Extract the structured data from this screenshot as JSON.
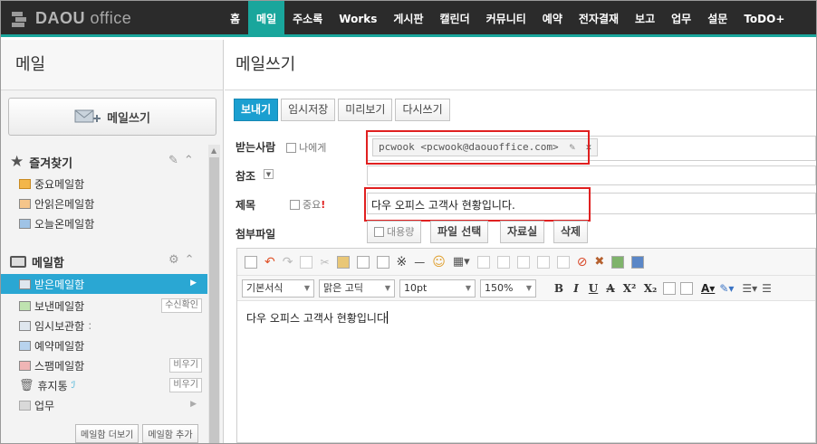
{
  "app": {
    "logo_bold": "DAOU",
    "logo_light": "office"
  },
  "nav": [
    {
      "label": "홈"
    },
    {
      "label": "메일"
    },
    {
      "label": "주소록"
    },
    {
      "label": "Works"
    },
    {
      "label": "게시판"
    },
    {
      "label": "캘린더"
    },
    {
      "label": "커뮤니티"
    },
    {
      "label": "예약"
    },
    {
      "label": "전자결재"
    },
    {
      "label": "보고"
    },
    {
      "label": "업무"
    },
    {
      "label": "설문"
    },
    {
      "label": "ToDO+"
    }
  ],
  "nav_active_index": 1,
  "sidebar": {
    "title": "메일",
    "compose_label": "메일쓰기",
    "favorites": {
      "label": "즐겨찾기",
      "items": [
        {
          "label": "중요메일함"
        },
        {
          "label": "안읽은메일함"
        },
        {
          "label": "오늘온메일함"
        }
      ]
    },
    "mailbox": {
      "label": "메일함",
      "items": [
        {
          "label": "받은메일함",
          "selected": true
        },
        {
          "label": "보낸메일함",
          "tag": "수신확인"
        },
        {
          "label": "임시보관함",
          "suffix": ":"
        },
        {
          "label": "예약메일함"
        },
        {
          "label": "스팸메일함",
          "tag": "비우기"
        },
        {
          "label": "휴지통",
          "tag": "비우기",
          "suffix": "ℐ"
        },
        {
          "label": "업무"
        }
      ]
    },
    "more_label": "메일함 더보기",
    "add_label": "메일함 추가"
  },
  "main": {
    "title": "메일쓰기",
    "buttons": {
      "send": "보내기",
      "temp_save": "임시저장",
      "preview": "미리보기",
      "rewrite": "다시쓰기"
    },
    "to": {
      "label": "받는사람",
      "self_option": "나에게",
      "recipient": "pcwook <pcwook@daouoffice.com>"
    },
    "cc": {
      "label": "참조"
    },
    "subject": {
      "label": "제목",
      "important_option": "중요",
      "important_mark": "!",
      "value": "다우 오피스 고객사 현황입니다."
    },
    "attach": {
      "label": "첨부파일",
      "large_option": "대용량",
      "select_file": "파일 선택",
      "library": "자료실",
      "delete": "삭제"
    },
    "editor": {
      "style": "기본서식",
      "font": "맑은 고딕",
      "size": "10pt",
      "zoom": "150%",
      "format_buttons": [
        "B",
        "I",
        "U",
        "A",
        "X²",
        "X₂"
      ],
      "body": "다우 오피스 고객사 현황입니다"
    }
  },
  "colors": {
    "accent": "#19a69c",
    "topbar": "#2b2b2b",
    "selected": "#2aa7d3",
    "highlight_box": "#e02020"
  }
}
